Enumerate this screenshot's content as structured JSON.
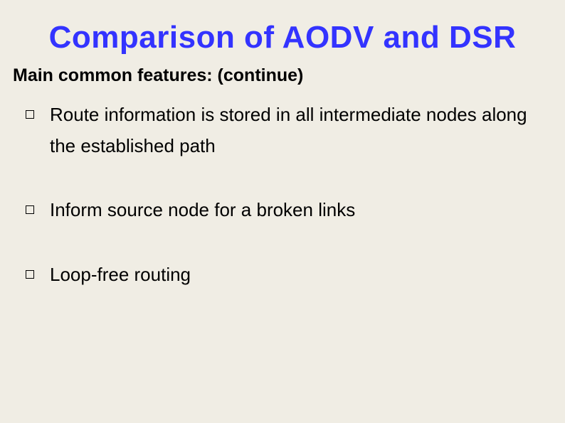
{
  "title": "Comparison of AODV and DSR",
  "subtitle": "Main common features: (continue)",
  "bullets": [
    "Route information is stored in all intermediate nodes along the established path",
    "Inform source node for a broken links",
    "Loop-free routing"
  ]
}
